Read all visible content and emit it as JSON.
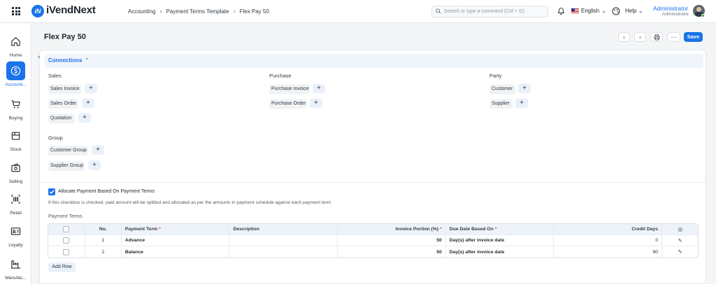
{
  "app": {
    "name": "iVendNext",
    "logo_letter": "iN",
    "accent": "#1a73e8"
  },
  "breadcrumb": [
    "Accounting",
    "Payment Terms Template",
    "Flex Pay 50"
  ],
  "search": {
    "placeholder": "Search or type a command (Ctrl + G)"
  },
  "header_right": {
    "language": "English",
    "help": "Help",
    "user_name": "Administrator",
    "user_role": "Administrator"
  },
  "sidebar": {
    "items": [
      {
        "label": "Home",
        "icon": "home-icon"
      },
      {
        "label": "Accounti...",
        "icon": "dollar-icon",
        "active": true
      },
      {
        "label": "Buying",
        "icon": "cart-icon"
      },
      {
        "label": "Stock",
        "icon": "box-icon"
      },
      {
        "label": "Selling",
        "icon": "wallet-icon"
      },
      {
        "label": "Retail",
        "icon": "barcode-icon"
      },
      {
        "label": "Loyalty",
        "icon": "card-icon"
      },
      {
        "label": "Manufac...",
        "icon": "factory-icon"
      }
    ]
  },
  "page": {
    "title": "Flex Pay 50",
    "save_label": "Save",
    "more_label": "···"
  },
  "connections": {
    "title": "Connections",
    "groups": [
      {
        "title": "Sales",
        "items": [
          "Sales Invoice",
          "Sales Order",
          "Quotation"
        ]
      },
      {
        "title": "Purchase",
        "items": [
          "Purchase Invoice",
          "Purchase Order"
        ]
      },
      {
        "title": "Party",
        "items": [
          "Customer",
          "Supplier"
        ]
      },
      {
        "title": "Group",
        "items": [
          "Customer Group",
          "Supplier Group"
        ]
      }
    ],
    "add_symbol": "+"
  },
  "allocate": {
    "label": "Allocate Payment Based On Payment Terms",
    "checked": true,
    "description": "If this checkbox is checked, paid amount will be splitted and allocated as per the amounts in payment schedule against each payment term"
  },
  "payment_terms": {
    "label": "Payment Terms",
    "columns": [
      "No.",
      "Payment Term",
      "Description",
      "Invoice Portion (%)",
      "Due Date Based On",
      "Credit Days"
    ],
    "required_mark": "*",
    "rows": [
      {
        "no": "1",
        "term": "Advance",
        "description": "",
        "portion": "50",
        "due": "Day(s) after invoice date",
        "credit_days": "0"
      },
      {
        "no": "2",
        "term": "Balance",
        "description": "",
        "portion": "50",
        "due": "Day(s) after invoice date",
        "credit_days": "90"
      }
    ],
    "add_row_label": "Add Row"
  }
}
